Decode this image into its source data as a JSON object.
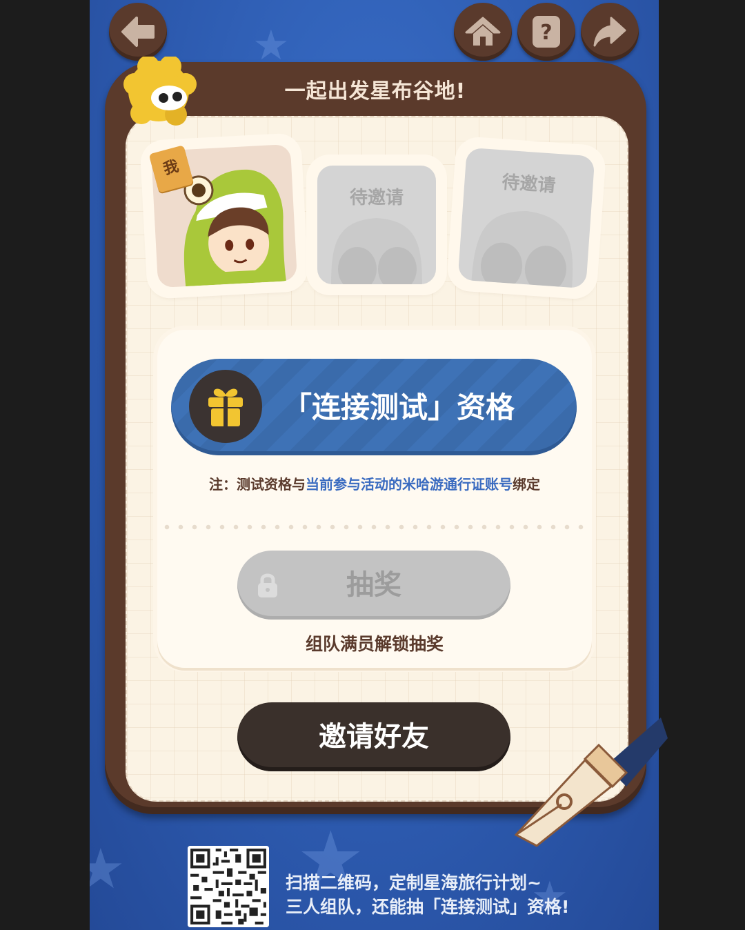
{
  "title": "一起出发星布谷地!",
  "nav": {
    "back_icon": "back-arrow-icon",
    "home_icon": "home-icon",
    "help_icon": "question-icon",
    "share_icon": "share-arrow-icon"
  },
  "team": {
    "me_badge": "我",
    "slots": [
      {
        "state": "me"
      },
      {
        "label": "待邀请"
      },
      {
        "label": "待邀请"
      }
    ]
  },
  "reward": {
    "icon": "gift-icon",
    "qualification": "「连接测试」资格",
    "note_prefix": "注：测试资格与",
    "note_link": "当前参与活动的米哈游通行证账号",
    "note_suffix": "绑定",
    "draw_label": "抽奖",
    "draw_icon": "lock-icon",
    "unlock_hint": "组队满员解锁抽奖"
  },
  "invite_button": "邀请好友",
  "footer": {
    "line1": "扫描二维码，定制星海旅行计划~",
    "line2": "三人组队，还能抽「连接测试」资格!"
  },
  "colors": {
    "background": "#2d5bb0",
    "board": "#5b3a2b",
    "paper": "#fbf3e4",
    "accent_blue": "#3e72b6",
    "link": "#3a6bc0",
    "button_dark": "#3a302b",
    "button_disabled": "#c3c3c3"
  }
}
